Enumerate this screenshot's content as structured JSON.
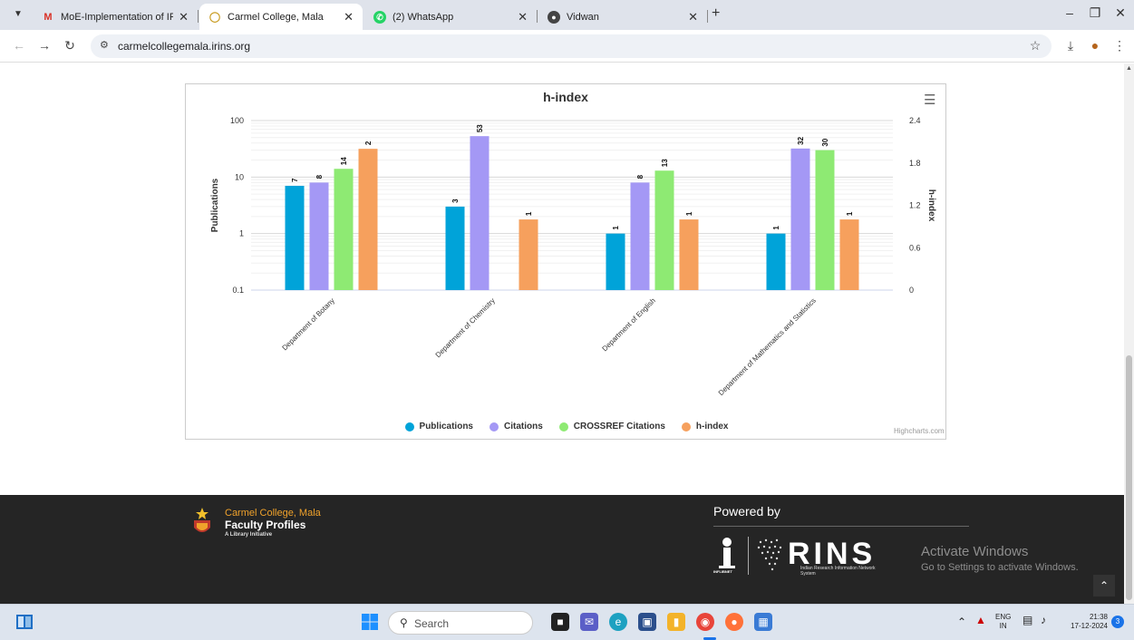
{
  "browser": {
    "tabs": [
      {
        "label": "MoE-Implementation of IRINS",
        "icon": "gmail-icon",
        "active": false
      },
      {
        "label": "Carmel College, Mala",
        "icon": "irins-site-icon",
        "active": true
      },
      {
        "label": "(2) WhatsApp",
        "icon": "whatsapp-icon",
        "active": false
      },
      {
        "label": "Vidwan",
        "icon": "globe-icon",
        "active": false
      }
    ],
    "url": "carmelcollegemala.irins.org"
  },
  "chart_data": {
    "type": "bar",
    "title": "h-index",
    "categories": [
      "Department of Botany",
      "Department of Chemistry",
      "Department of English",
      "Department of Mathematics and Statistics"
    ],
    "series": [
      {
        "name": "Publications",
        "color": "#00a3d9",
        "axis": "left",
        "values": [
          7,
          3,
          1,
          1
        ]
      },
      {
        "name": "Citations",
        "color": "#a498f5",
        "axis": "left",
        "values": [
          8,
          53,
          8,
          32
        ]
      },
      {
        "name": "CROSSREF Citations",
        "color": "#8eea73",
        "axis": "left",
        "values": [
          14,
          null,
          13,
          30
        ]
      },
      {
        "name": "h-index",
        "color": "#f6a05d",
        "axis": "right",
        "values": [
          2,
          1,
          1,
          1
        ]
      }
    ],
    "ylabel": "Publications",
    "y2label": "h-index",
    "yscale": "log",
    "ylim": [
      0.1,
      100
    ],
    "yticks": [
      "100",
      "10",
      "1",
      "0.1"
    ],
    "y2lim": [
      0,
      2.4
    ],
    "y2ticks": [
      "2.4",
      "1.8",
      "1.2",
      "0.6",
      "0"
    ],
    "legend_position": "bottom",
    "credits": "Highcharts.com"
  },
  "footer": {
    "college_name": "Carmel College, Mala",
    "subtitle": "Faculty Profiles",
    "tagline": "A Library Initiative",
    "powered_by": "Powered by",
    "irins_word": "RINS",
    "irins_caption": "Indian Research Information Network System",
    "inflibnet": "INFLIBNET",
    "activate_title": "Activate Windows",
    "activate_sub": "Go to Settings to activate Windows."
  },
  "taskbar": {
    "search_placeholder": "Search",
    "lang_top": "ENG",
    "lang_bottom": "IN",
    "time": "21:38",
    "date": "17-12-2024",
    "notification_count": "3"
  }
}
